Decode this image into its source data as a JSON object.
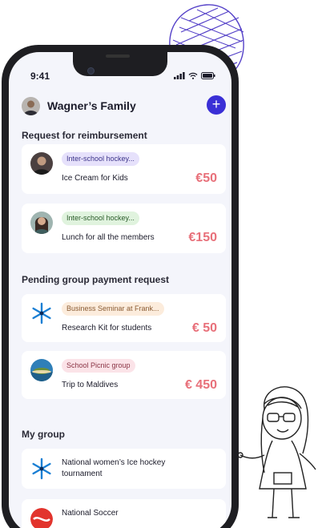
{
  "status": {
    "time": "9:41"
  },
  "header": {
    "family_name": "Wagner’s Family",
    "add_label": "+"
  },
  "sections": {
    "reimbursement_title": "Request for reimbursement",
    "pending_title": "Pending group payment request",
    "groups_title": "My group"
  },
  "reimbursements": [
    {
      "tag": "Inter-school hockey...",
      "description": "Ice Cream for Kids",
      "amount": "€50"
    },
    {
      "tag": "Inter-school hockey...",
      "description": "Lunch for all the members",
      "amount": "€150"
    }
  ],
  "pending": [
    {
      "tag": "Business Seminar at Frank...",
      "description": "Research Kit for students",
      "amount": "€ 50"
    },
    {
      "tag": "School Picnic group",
      "description": "Trip to Maldives",
      "amount": "€ 450"
    }
  ],
  "groups": [
    {
      "title": "National women’s Ice hockey tournament"
    },
    {
      "title": "National Soccer"
    }
  ],
  "colors": {
    "accent": "#3a2fd6",
    "amount": "#e8707a",
    "screen_bg": "#f4f5fb"
  }
}
